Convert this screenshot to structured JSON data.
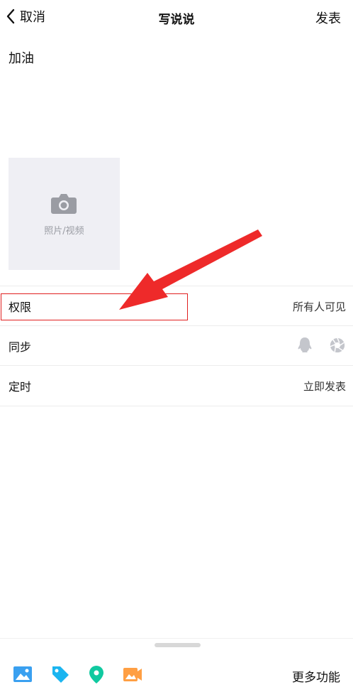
{
  "header": {
    "back_label": "取消",
    "title": "写说说",
    "publish_label": "发表"
  },
  "post": {
    "text": "加油"
  },
  "media": {
    "add_label": "照片/视频"
  },
  "settings": {
    "permission": {
      "label": "权限",
      "value": "所有人可见"
    },
    "sync": {
      "label": "同步"
    },
    "schedule": {
      "label": "定时",
      "value": "立即发表"
    }
  },
  "toolbar": {
    "more_label": "更多功能"
  },
  "colors": {
    "highlight": "#e02020",
    "arrow": "#ee2a2a",
    "tag": "#1bb5f0",
    "location": "#10c9a0",
    "photo": "#3aa0f0",
    "video": "#ff9f43"
  }
}
